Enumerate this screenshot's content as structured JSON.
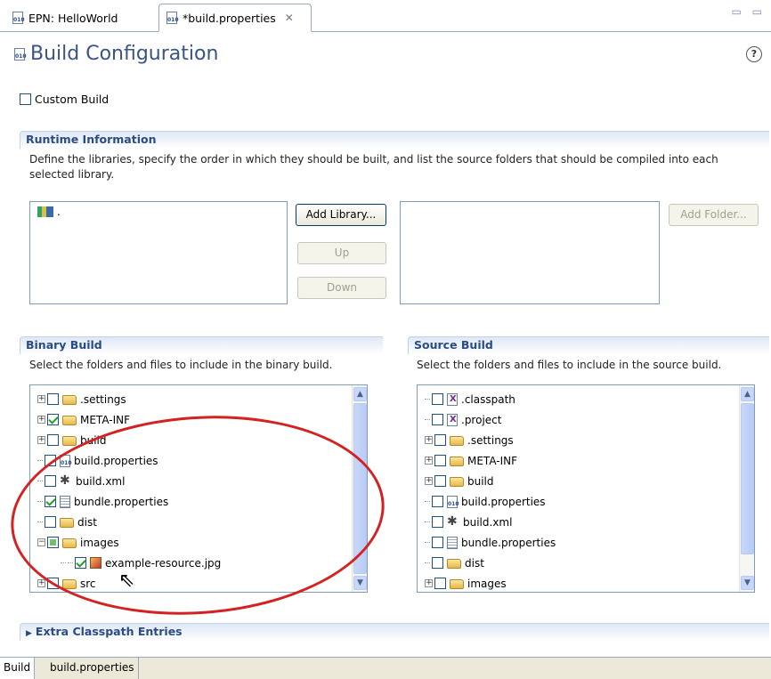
{
  "tabs": [
    {
      "label": "EPN: HelloWorld",
      "active": false
    },
    {
      "label": "*build.properties",
      "active": true
    }
  ],
  "header": {
    "title": "Build Configuration",
    "help_icon": "help-icon"
  },
  "custom_build": {
    "label": "Custom Build",
    "checked": false
  },
  "runtime": {
    "title": "Runtime Information",
    "description": "Define the libraries, specify the order in which they should be built, and list the source folders that should be compiled into each selected library.",
    "libraries": [
      "."
    ],
    "buttons": {
      "add_library": "Add Library...",
      "up": "Up",
      "down": "Down",
      "add_folder": "Add Folder..."
    }
  },
  "binary_build": {
    "title": "Binary Build",
    "description": "Select the folders and files to include in the binary build.",
    "items": [
      {
        "label": ".settings",
        "type": "folder",
        "expand": "plus",
        "state": "unchecked",
        "indent": 0
      },
      {
        "label": "META-INF",
        "type": "folder",
        "expand": "plus",
        "state": "checked",
        "indent": 0
      },
      {
        "label": "build",
        "type": "folder",
        "expand": "plus",
        "state": "unchecked",
        "indent": 0
      },
      {
        "label": "build.properties",
        "type": "props",
        "expand": "none",
        "state": "unchecked",
        "indent": 0
      },
      {
        "label": "build.xml",
        "type": "ant",
        "expand": "none",
        "state": "unchecked",
        "indent": 0
      },
      {
        "label": "bundle.properties",
        "type": "text",
        "expand": "none",
        "state": "checked",
        "indent": 0
      },
      {
        "label": "dist",
        "type": "folder",
        "expand": "none",
        "state": "unchecked",
        "indent": 0
      },
      {
        "label": "images",
        "type": "folder",
        "expand": "minus",
        "state": "partial",
        "indent": 0
      },
      {
        "label": "example-resource.jpg",
        "type": "image",
        "expand": "none",
        "state": "checked",
        "indent": 1
      },
      {
        "label": "src",
        "type": "folder",
        "expand": "plus",
        "state": "unchecked",
        "indent": 0
      }
    ]
  },
  "source_build": {
    "title": "Source Build",
    "description": "Select the folders and files to include in the source build.",
    "items": [
      {
        "label": ".classpath",
        "type": "x",
        "expand": "none",
        "state": "unchecked"
      },
      {
        "label": ".project",
        "type": "x",
        "expand": "none",
        "state": "unchecked"
      },
      {
        "label": ".settings",
        "type": "folder",
        "expand": "plus",
        "state": "unchecked"
      },
      {
        "label": "META-INF",
        "type": "folder",
        "expand": "plus",
        "state": "unchecked"
      },
      {
        "label": "build",
        "type": "folder",
        "expand": "plus",
        "state": "unchecked"
      },
      {
        "label": "build.properties",
        "type": "props",
        "expand": "none",
        "state": "unchecked"
      },
      {
        "label": "build.xml",
        "type": "ant",
        "expand": "none",
        "state": "unchecked"
      },
      {
        "label": "bundle.properties",
        "type": "text",
        "expand": "none",
        "state": "unchecked"
      },
      {
        "label": "dist",
        "type": "folder",
        "expand": "none",
        "state": "unchecked"
      },
      {
        "label": "images",
        "type": "folder",
        "expand": "plus",
        "state": "unchecked"
      }
    ]
  },
  "extra_classpath": {
    "title": "Extra Classpath Entries",
    "expanded": false
  },
  "bottom_tabs": [
    {
      "label": "Build",
      "active": true
    },
    {
      "label": "build.properties",
      "active": false
    }
  ],
  "colors": {
    "title": "#3a5486",
    "section_title": "#2a4c86",
    "annotation": "#d42121"
  }
}
